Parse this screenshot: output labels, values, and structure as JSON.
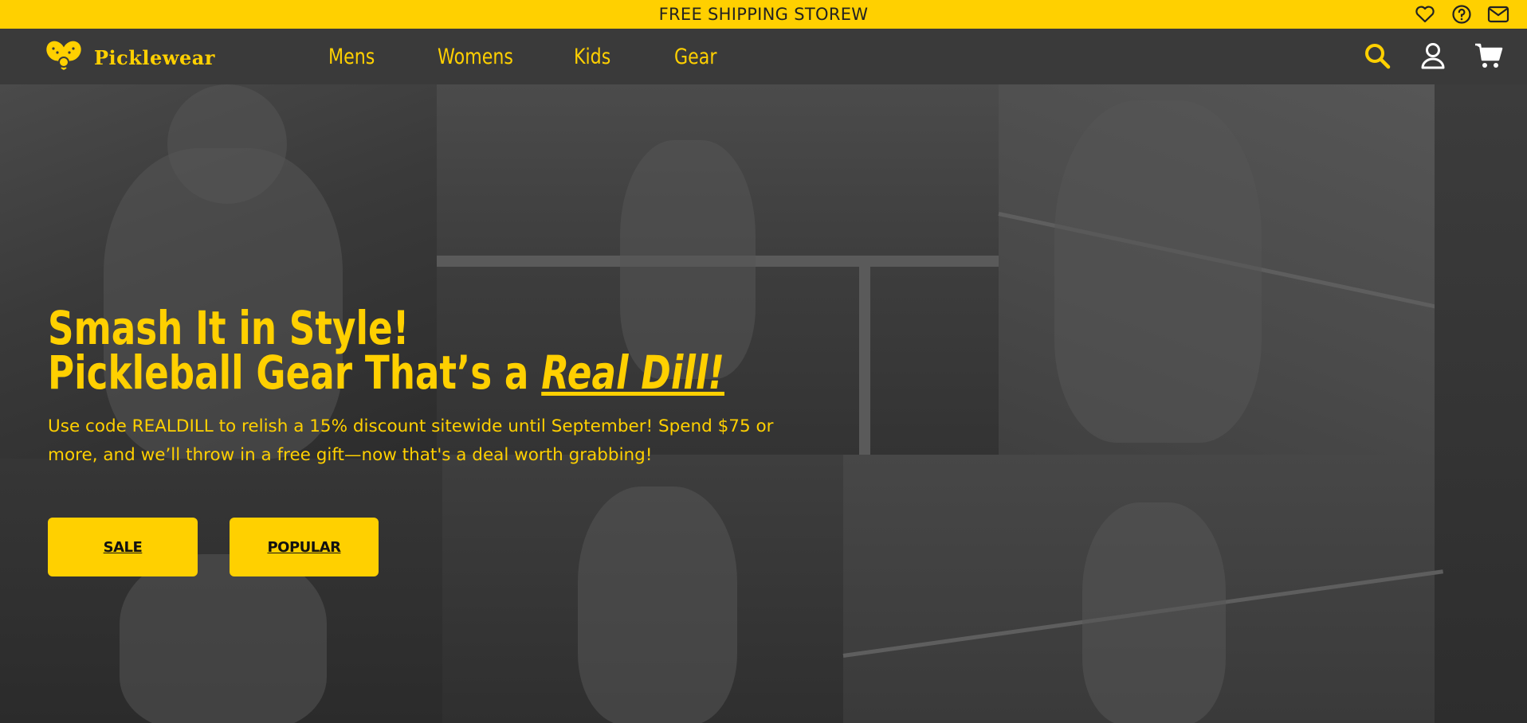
{
  "announcement": {
    "text": "FREE SHIPPING STOREW"
  },
  "topbar_icons": [
    "heart-icon",
    "help-circle-icon",
    "mail-icon"
  ],
  "brand": {
    "name": "Picklewear",
    "accent": "#ffd000"
  },
  "nav": {
    "items": [
      {
        "label": "Mens"
      },
      {
        "label": "Womens"
      },
      {
        "label": "Kids"
      },
      {
        "label": "Gear"
      }
    ],
    "right_icons": [
      "search-icon",
      "account-icon",
      "cart-icon"
    ]
  },
  "hero": {
    "headline_line1": "Smash It in Style!",
    "headline_line2_prefix": "Pickleball Gear That’s a ",
    "headline_line2_emphasis": "Real Dill!",
    "subtext": "Use code REALDILL to relish a 15% discount sitewide until September! Spend $75 or more, and we’ll throw in a free gift—now that's a deal worth grabbing!",
    "buttons": {
      "sale": "SALE",
      "popular": "POPULAR"
    }
  },
  "colors": {
    "topbar": "#ffd000",
    "nav_bg": "#3a3a3a",
    "hero_text": "#ffd000"
  }
}
